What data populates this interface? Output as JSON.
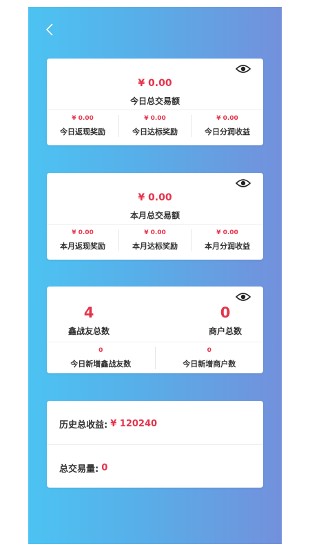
{
  "nav": {
    "back_icon": "chevron-left-icon"
  },
  "today": {
    "total_amount": "¥ 0.00",
    "total_label": "今日总交易额",
    "items": [
      {
        "amount": "¥ 0.00",
        "label": "今日返现奖励"
      },
      {
        "amount": "¥ 0.00",
        "label": "今日达标奖励"
      },
      {
        "amount": "¥ 0.00",
        "label": "今日分润收益"
      }
    ]
  },
  "month": {
    "total_amount": "¥ 0.00",
    "total_label": "本月总交易额",
    "items": [
      {
        "amount": "¥ 0.00",
        "label": "本月返现奖励"
      },
      {
        "amount": "¥ 0.00",
        "label": "本月达标奖励"
      },
      {
        "amount": "¥ 0.00",
        "label": "本月分润收益"
      }
    ]
  },
  "counts": {
    "friends_total": "4",
    "friends_total_label": "鑫战友总数",
    "merchants_total": "0",
    "merchants_total_label": "商户总数",
    "new_friends_today": "0",
    "new_friends_today_label": "今日新增鑫战友数",
    "new_merchants_today": "0",
    "new_merchants_today_label": "今日新增商户数"
  },
  "history": {
    "income_label": "历史总收益:",
    "income_value": "¥ 120240",
    "volume_label": "总交易量:",
    "volume_value": "0"
  },
  "colors": {
    "accent": "#e5334b",
    "gradient_start": "#4cc3f2",
    "gradient_end": "#7390dc"
  }
}
